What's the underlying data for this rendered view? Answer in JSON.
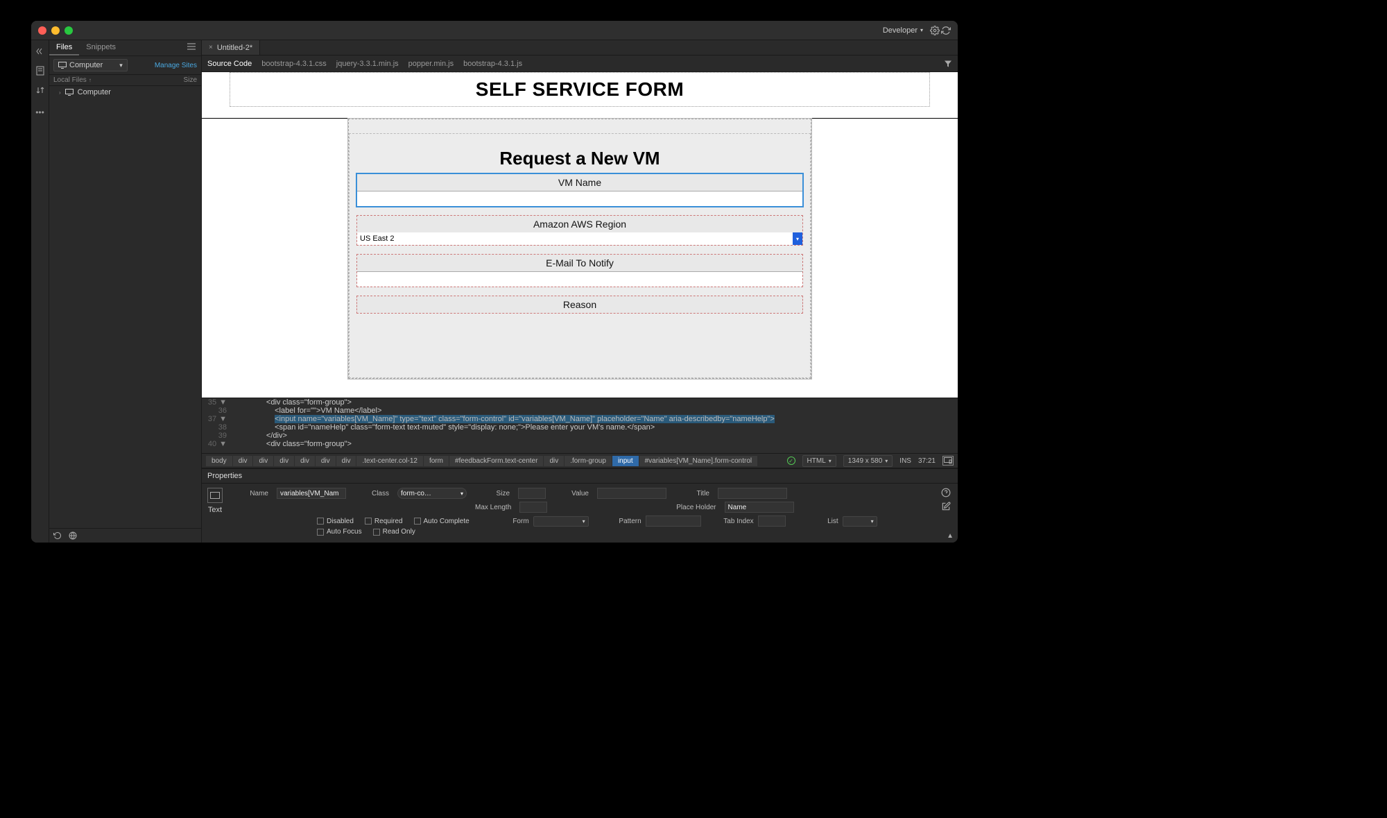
{
  "titlebar": {
    "workspace": "Developer"
  },
  "sidebar": {
    "tabs": {
      "files": "Files",
      "snippets": "Snippets"
    },
    "siteDropdown": "Computer",
    "manageSites": "Manage Sites",
    "cols": {
      "c1": "Local Files",
      "c2": "Size"
    },
    "tree": {
      "root": "Computer"
    }
  },
  "docTabs": {
    "t1": "Untitled-2*"
  },
  "subnav": {
    "items": [
      "Source Code",
      "bootstrap-4.3.1.css",
      "jquery-3.3.1.min.js",
      "popper.min.js",
      "bootstrap-4.3.1.js"
    ]
  },
  "preview": {
    "banner": "SELF SERVICE FORM",
    "cardTitle": "Request a New VM",
    "labels": {
      "vmname": "VM Name",
      "region": "Amazon AWS Region",
      "email": "E-Mail To Notify",
      "reason": "Reason"
    },
    "regionValue": "US East 2"
  },
  "code": {
    "l35n": "35",
    "l35t": "                <div class=\"form-group\">",
    "l36n": "36",
    "l36t": "                    <label for=\"\">VM Name</label>",
    "l37n": "37",
    "l37a": "                    ",
    "l37b": "<input name=\"variables[VM_Name]\" type=\"text\" class=\"form-control\" id=\"variables[VM_Name]\" placeholder=\"Name\" aria-describedby=\"nameHelp\">",
    "l38n": "38",
    "l38t": "                    <span id=\"nameHelp\" class=\"form-text text-muted\" style=\"display: none;\">Please enter your VM's name.</span>",
    "l39n": "39",
    "l39t": "                </div>",
    "l40n": "40",
    "l40t": "                <div class=\"form-group\">"
  },
  "breadcrumb": {
    "items": [
      "body",
      "div",
      "div",
      "div",
      "div",
      "div",
      "div",
      ".text-center.col-12",
      "form",
      "#feedbackForm.text-center",
      "div",
      ".form-group",
      "input",
      "#variables[VM_Name].form-control"
    ],
    "lang": "HTML",
    "dims": "1349 x 580",
    "mode": "INS",
    "pos": "37:21"
  },
  "props": {
    "title": "Properties",
    "elType": "Text",
    "name": "variables[VM_Nam",
    "class": "form-co…",
    "sizeLabel": "Size",
    "valueLabel": "Value",
    "titleLabel": "Title",
    "maxlenLabel": "Max Length",
    "placeholderLabel": "Place Holder",
    "placeholderValue": "Name",
    "disabled": "Disabled",
    "required": "Required",
    "autocomplete": "Auto Complete",
    "autofocus": "Auto Focus",
    "readonly": "Read Only",
    "formLabel": "Form",
    "patternLabel": "Pattern",
    "tabindexLabel": "Tab Index",
    "listLabel": "List",
    "nameLabel": "Name",
    "classLabel": "Class"
  }
}
